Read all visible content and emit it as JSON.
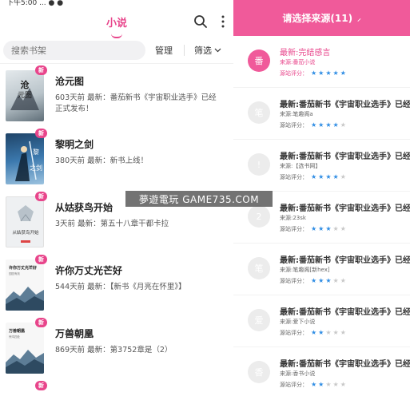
{
  "statusbar": {
    "text": "下午5:00 ... ● ●"
  },
  "header": {
    "tab_label": "小说"
  },
  "toolbar": {
    "search_placeholder": "搜索书架",
    "manage_label": "管理",
    "filter_label": "筛选"
  },
  "books": [
    {
      "title": "沧元图",
      "info": "603天前 最新：番茄新书《宇宙职业选手》已经正式发布！",
      "badge": "新",
      "cover_text": "沧元图",
      "cover_color": "#cfd8dc"
    },
    {
      "title": "黎明之剑",
      "info": "380天前 最新：新书上线！",
      "badge": "新",
      "cover_text": "黎明之剑",
      "cover_color": "#3b6e9e"
    },
    {
      "title": "从姑获鸟开始",
      "info": "3天前 最新：第五十八章干都卡拉",
      "badge": "新",
      "cover_text": "从姑获鸟开始",
      "cover_color": "#eceff1"
    },
    {
      "title": "许你万丈光芒好",
      "info": "544天前 最新：【新书《月亮在怀里》】",
      "badge": "新",
      "cover_text": "许你万丈光芒好",
      "cover_color": "#f5f5f5"
    },
    {
      "title": "万兽朝凰",
      "info": "869天前 最新：第3752章是（2）",
      "badge": "新",
      "cover_text": "万兽朝凰",
      "cover_color": "#f5f5f5"
    }
  ],
  "overflow_badge": "新",
  "watermark": "夢遊電玩 GAME735.COM",
  "source_panel": {
    "title": "请选择来源(11)",
    "rating_label": "源站评分：",
    "sources": [
      {
        "avatar": "番",
        "title": "最新:完结感言",
        "origin": "来源:番茄小说",
        "rating": 5,
        "active": true
      },
      {
        "avatar": "笔",
        "title": "最新:番茄新书《宇宙职业选手》已经…",
        "origin": "来源:笔趣阁a",
        "rating": 4,
        "active": false
      },
      {
        "avatar": "!",
        "title": "最新:番茄新书《宇宙职业选手》已经…",
        "origin": "来源:【选书网】",
        "rating": 4,
        "active": false
      },
      {
        "avatar": "2",
        "title": "最新:番茄新书《宇宙职业选手》已经…",
        "origin": "来源:23sk",
        "rating": 3,
        "active": false
      },
      {
        "avatar": "笔",
        "title": "最新:番茄新书《宇宙职业选手》已经…",
        "origin": "来源:笔趣阁[新hex]",
        "rating": 3,
        "active": false
      },
      {
        "avatar": "爱",
        "title": "最新:番茄新书《宇宙职业选手》已经…",
        "origin": "来源:爱下小说",
        "rating": 2,
        "active": false
      },
      {
        "avatar": "香",
        "title": "最新:番茄新书《宇宙职业选手》已经…",
        "origin": "来源:香书小说",
        "rating": 2,
        "active": false
      }
    ]
  },
  "colors": {
    "accent": "#e8458b",
    "header_bg": "#f05a9a",
    "star_on": "#2f8de4",
    "star_off": "#c8c8c8"
  },
  "icons": [
    "search-icon",
    "more-vertical-icon",
    "chevron-down-icon",
    "star-icon"
  ]
}
